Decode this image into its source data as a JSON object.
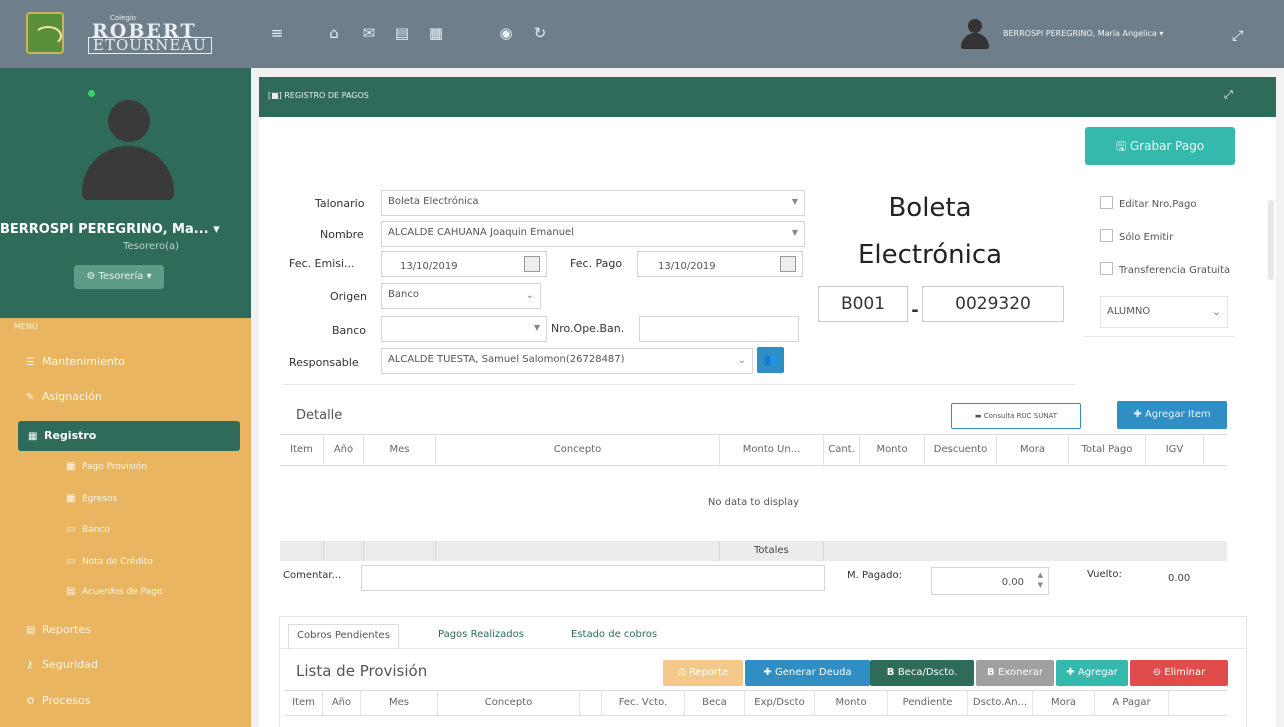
{
  "header": {
    "logo_small": "Colegio",
    "logo_line1": "ROBERT",
    "logo_line2": "ETOURNEAU",
    "icons": [
      "menu-icon",
      "home-icon",
      "mail-icon",
      "document-icon",
      "calendar-icon",
      "camera-icon",
      "refresh-icon"
    ],
    "user_name": "BERROSPI PEREGRINO, María Angelica ▾"
  },
  "sidebar": {
    "user_name": "BERROSPI PEREGRINO, Ma... ▾",
    "role": "Tesorero(a)",
    "role_button": "⚙ Tesorería ▾",
    "menu_label": "MENÚ",
    "items": [
      {
        "label": "Mantenimiento"
      },
      {
        "label": "Asignación"
      },
      {
        "label": "Registro"
      },
      {
        "label": "Reportes"
      },
      {
        "label": "Seguridad"
      },
      {
        "label": "Procesos"
      }
    ],
    "subitems": [
      {
        "label": "Pago Provisión"
      },
      {
        "label": "Egresos"
      },
      {
        "label": "Banco"
      },
      {
        "label": "Nota de Crédito"
      },
      {
        "label": "Acuerdos de Pago"
      }
    ]
  },
  "panel": {
    "title": "REGISTRO DE PAGOS",
    "save_button": "Grabar Pago"
  },
  "form": {
    "talonario_label": "Talonario",
    "talonario_value": "Boleta Electrónica",
    "nombre_label": "Nombre",
    "nombre_value": "ALCALDE CAHUANA Joaquin Emanuel",
    "fec_emision_label": "Fec. Emisi...",
    "fec_emision_value": "13/10/2019",
    "fec_pago_label": "Fec. Pago",
    "fec_pago_value": "13/10/2019",
    "origen_label": "Origen",
    "origen_value": "Banco",
    "banco_label": "Banco",
    "banco_value": "",
    "nro_ope_label": "Nro.Ope.Ban.",
    "nro_ope_value": "",
    "responsable_label": "Responsable",
    "responsable_value": "ALCALDE TUESTA, Samuel Salomon(26728487)"
  },
  "document": {
    "title_line1": "Boleta",
    "title_line2": "Electrónica",
    "serie": "B001",
    "separator": "-",
    "numero": "0029320"
  },
  "options": {
    "editar": "Editar Nro.Pago",
    "solo_emitir": "Sólo Emitir",
    "transferencia": "Transferencia Gratuita",
    "tipo_value": "ALUMNO"
  },
  "detalle": {
    "title": "Detalle",
    "consulta_button": "Consulta RUC SUNAT",
    "agregar_item_button": "Agregar Item",
    "columns": [
      "Item",
      "Año",
      "Mes",
      "Concepto",
      "Monto Un...",
      "Cant.",
      "Monto",
      "Descuento",
      "Mora",
      "Total Pago",
      "IGV"
    ],
    "empty_text": "No data to display",
    "totales_label": "Totales"
  },
  "footer_form": {
    "comentario_label": "Comentar...",
    "comentario_value": "",
    "m_pagado_label": "M. Pagado:",
    "m_pagado_value": "0.00",
    "vuelto_label": "Vuelto:",
    "vuelto_value": "0.00"
  },
  "tabs": [
    "Cobros Pendientes",
    "Pagos Realizados",
    "Estado de cobros"
  ],
  "provision": {
    "title": "Lista de Provisión",
    "buttons": [
      "Reporte",
      "Generar Deuda",
      "Beca/Dscto.",
      "Exonerar",
      "Agregar",
      "Eliminar"
    ],
    "columns": [
      "Item",
      "Año",
      "Mes",
      "Concepto",
      "",
      "Fec. Vcto.",
      "Beca",
      "Exp/Dscto",
      "Monto",
      "Pendiente",
      "Dscto.An...",
      "Mora",
      "A Pagar"
    ]
  },
  "colors": {
    "topbar": "#6e7f8b",
    "sidebar_green": "#2f6b5a",
    "sidebar_orange": "#e9b560",
    "accent_teal": "#35b9ad",
    "accent_blue": "#2f8ec3"
  }
}
